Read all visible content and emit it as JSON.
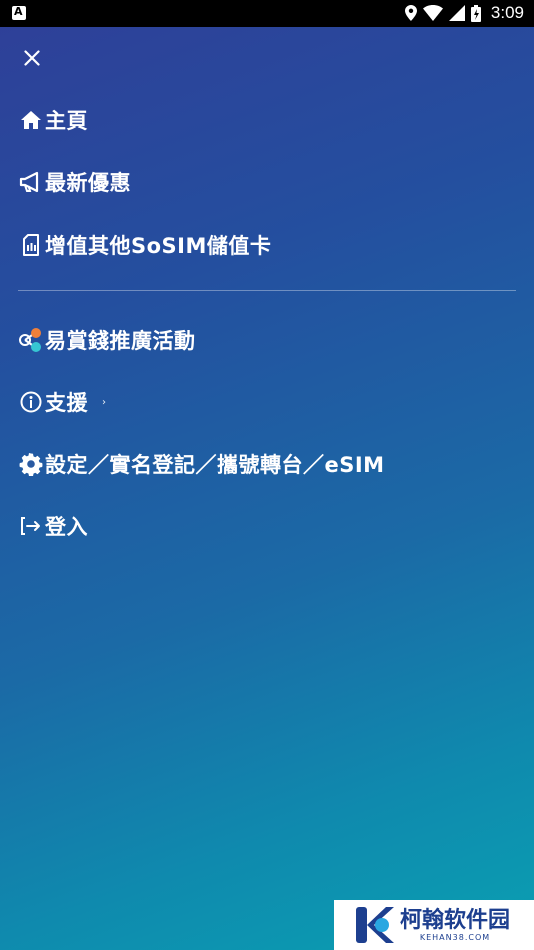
{
  "status_bar": {
    "left_icon": "A",
    "time": "3:09"
  },
  "menu": {
    "close_icon": "close-icon",
    "items": [
      {
        "label": "主頁",
        "icon": "home-icon"
      },
      {
        "label": "最新優惠",
        "icon": "megaphone-icon"
      },
      {
        "label": "增值其他SoSIM儲值卡",
        "icon": "sim-card-icon"
      },
      {
        "label": "易賞錢推廣活動",
        "icon": "share-nodes-icon"
      },
      {
        "label": "支援",
        "icon": "info-icon",
        "chevron": "›"
      },
      {
        "label": "設定／實名登記／攜號轉台／eSIM",
        "icon": "gear-icon"
      },
      {
        "label": "登入",
        "icon": "sign-in-icon"
      }
    ]
  },
  "watermark": {
    "title": "柯翰软件园",
    "subtitle": "KEHAN38.COM"
  }
}
